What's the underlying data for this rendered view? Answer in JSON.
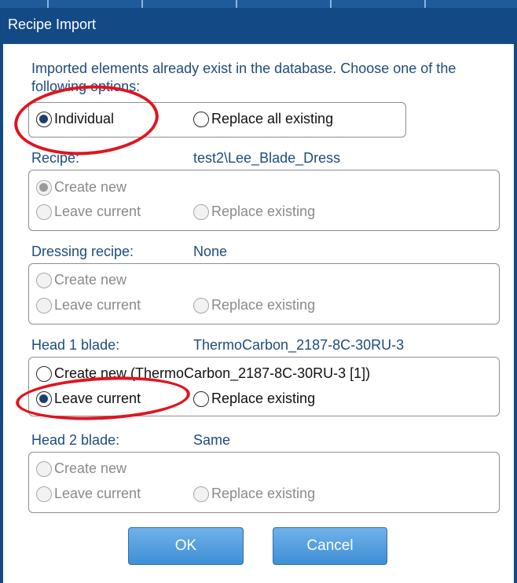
{
  "dialog": {
    "title": "Recipe Import",
    "message": "Imported elements already exist in the database. Choose one of the following options:"
  },
  "mode": {
    "individual": "Individual",
    "replace_all": "Replace all existing",
    "selected": "Individual"
  },
  "sections": {
    "recipe": {
      "label": "Recipe:",
      "value": "test2\\Lee_Blade_Dress",
      "create_new": "Create new",
      "leave_current": "Leave current",
      "replace_existing": "Replace existing",
      "selected": "Create new",
      "enabled": false
    },
    "dressing": {
      "label": "Dressing recipe:",
      "value": "None",
      "create_new": "Create new",
      "leave_current": "Leave current",
      "replace_existing": "Replace existing",
      "selected": "",
      "enabled": false
    },
    "head1": {
      "label": "Head 1 blade:",
      "value": "ThermoCarbon_2187-8C-30RU-3",
      "create_new": "Create new  (ThermoCarbon_2187-8C-30RU-3 [1])",
      "leave_current": "Leave current",
      "replace_existing": "Replace existing",
      "selected": "Leave current",
      "enabled": true
    },
    "head2": {
      "label": "Head 2 blade:",
      "value": "Same",
      "create_new": "Create new",
      "leave_current": "Leave current",
      "replace_existing": "Replace existing",
      "selected": "",
      "enabled": false
    }
  },
  "buttons": {
    "ok": "OK",
    "cancel": "Cancel"
  },
  "colors": {
    "titlebar": "#134a86",
    "label_text": "#1e4c7c",
    "annotation_ring": "#e0141e",
    "button": "#4a98dc"
  }
}
